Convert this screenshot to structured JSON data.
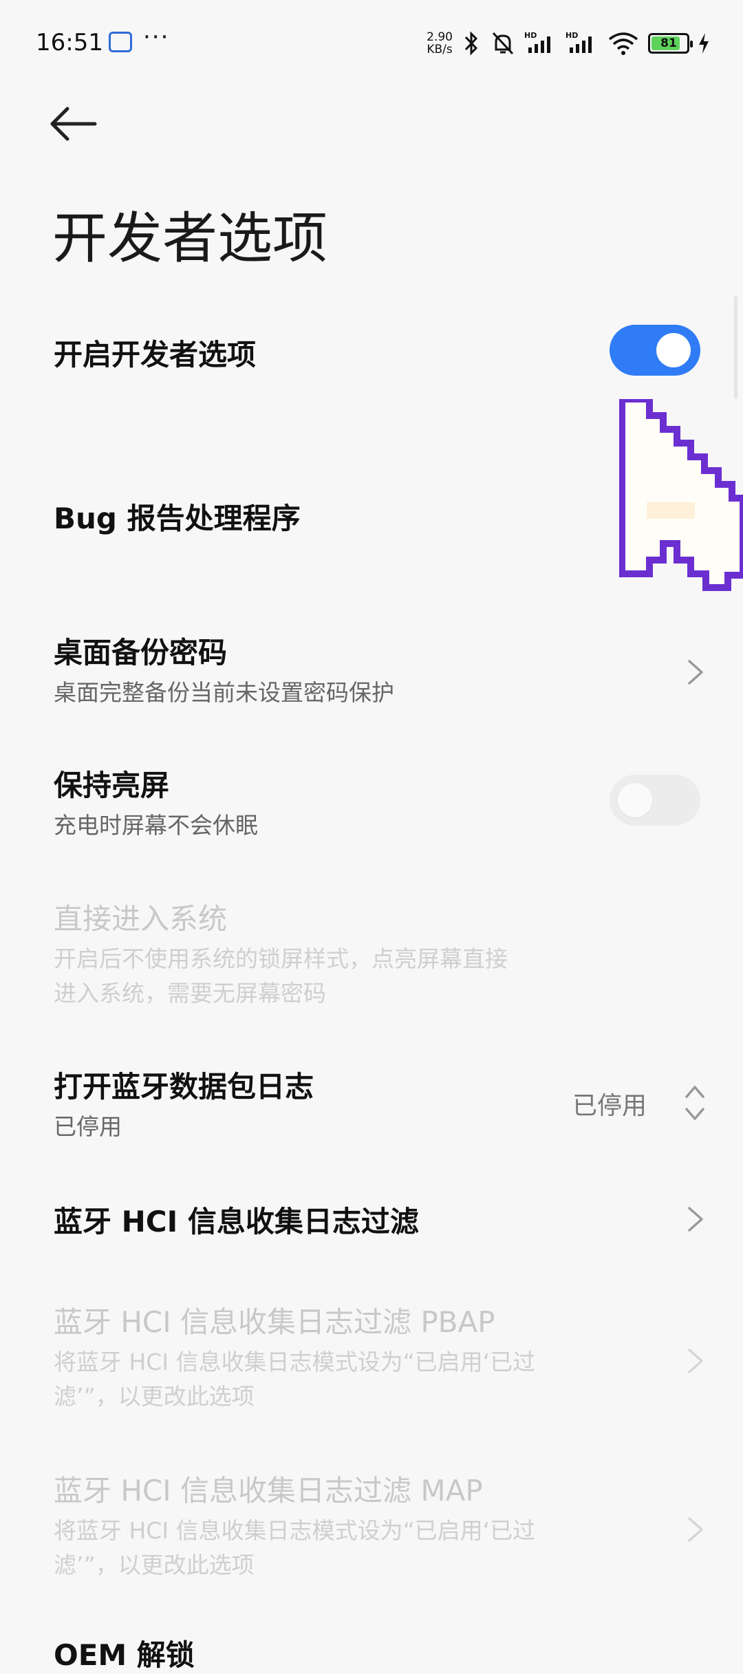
{
  "status": {
    "time": "16:51",
    "more": "···",
    "net_speed_value": "2.90",
    "net_speed_unit": "KB/s",
    "battery": "81",
    "battery_level": 0.81
  },
  "page": {
    "title": "开发者选项"
  },
  "settings": [
    {
      "title": "开启开发者选项",
      "control": "toggle",
      "state": "on"
    },
    {
      "title": "Bug 报告处理程序"
    },
    {
      "title": "桌面备份密码",
      "subtitle": "桌面完整备份当前未设置密码保护",
      "control": "chevron"
    },
    {
      "title": "保持亮屏",
      "subtitle": "充电时屏幕不会休眠",
      "control": "toggle",
      "state": "off"
    },
    {
      "title": "直接进入系统",
      "subtitle_line1": "开启后不使用系统的锁屏样式，点亮屏幕直接",
      "subtitle_line2": "进入系统，需要无屏幕密码",
      "disabled": true
    },
    {
      "title": "打开蓝牙数据包日志",
      "subtitle": "已停用",
      "value": "已停用",
      "control": "updown"
    },
    {
      "title": "蓝牙 HCI 信息收集日志过滤",
      "control": "chevron"
    },
    {
      "title": "蓝牙 HCI 信息收集日志过滤 PBAP",
      "subtitle_line1": "将蓝牙 HCI 信息收集日志模式设为“已启用‘已过",
      "subtitle_line2": "滤’”，以更改此选项",
      "control": "chevron",
      "disabled": true
    },
    {
      "title": "蓝牙 HCI 信息收集日志过滤 MAP",
      "subtitle_line1": "将蓝牙 HCI 信息收集日志模式设为“已启用‘已过",
      "subtitle_line2": "滤’”，以更改此选项",
      "control": "chevron",
      "disabled": true
    },
    {
      "title": "OEM 解锁"
    }
  ],
  "colors": {
    "accent": "#2f7cf6",
    "cursor": "#6b2fd1"
  }
}
